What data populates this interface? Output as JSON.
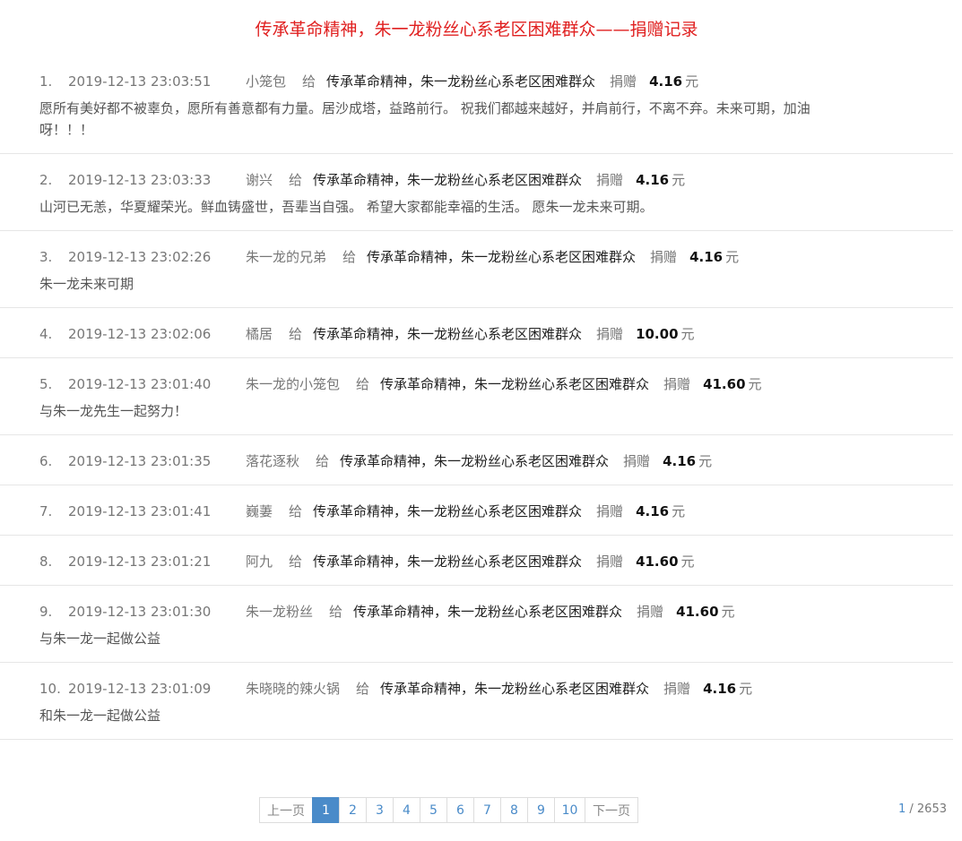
{
  "title": "传承革命精神，朱一龙粉丝心系老区困难群众——捐赠记录",
  "labels": {
    "give": "给",
    "donate": "捐赠",
    "unit": "元"
  },
  "records": [
    {
      "index": "1.",
      "time": "2019-12-13 23:03:51",
      "name": "小笼包",
      "project": "传承革命精神，朱一龙粉丝心系老区困难群众",
      "amount": "4.16",
      "message": "愿所有美好都不被辜负，愿所有善意都有力量。居沙成塔，益路前行。 祝我们都越来越好，并肩前行，不离不弃。未来可期，加油呀！！！"
    },
    {
      "index": "2.",
      "time": "2019-12-13 23:03:33",
      "name": "谢兴",
      "project": "传承革命精神，朱一龙粉丝心系老区困难群众",
      "amount": "4.16",
      "message": "山河已无恙，华夏耀荣光。鲜血铸盛世，吾辈当自强。 希望大家都能幸福的生活。 愿朱一龙未来可期。"
    },
    {
      "index": "3.",
      "time": "2019-12-13 23:02:26",
      "name": "朱一龙的兄弟",
      "project": "传承革命精神，朱一龙粉丝心系老区困难群众",
      "amount": "4.16",
      "message": "朱一龙未来可期"
    },
    {
      "index": "4.",
      "time": "2019-12-13 23:02:06",
      "name": "橘居",
      "project": "传承革命精神，朱一龙粉丝心系老区困难群众",
      "amount": "10.00",
      "message": ""
    },
    {
      "index": "5.",
      "time": "2019-12-13 23:01:40",
      "name": "朱一龙的小笼包",
      "project": "传承革命精神，朱一龙粉丝心系老区困难群众",
      "amount": "41.60",
      "message": "与朱一龙先生一起努力！"
    },
    {
      "index": "6.",
      "time": "2019-12-13 23:01:35",
      "name": "落花逐秋",
      "project": "传承革命精神，朱一龙粉丝心系老区困难群众",
      "amount": "4.16",
      "message": ""
    },
    {
      "index": "7.",
      "time": "2019-12-13 23:01:41",
      "name": "巍萋",
      "project": "传承革命精神，朱一龙粉丝心系老区困难群众",
      "amount": "4.16",
      "message": ""
    },
    {
      "index": "8.",
      "time": "2019-12-13 23:01:21",
      "name": "阿九",
      "project": "传承革命精神，朱一龙粉丝心系老区困难群众",
      "amount": "41.60",
      "message": ""
    },
    {
      "index": "9.",
      "time": "2019-12-13 23:01:30",
      "name": "朱一龙粉丝",
      "project": "传承革命精神，朱一龙粉丝心系老区困难群众",
      "amount": "41.60",
      "message": "与朱一龙一起做公益"
    },
    {
      "index": "10.",
      "time": "2019-12-13 23:01:09",
      "name": "朱晓晓的辣火锅",
      "project": "传承革命精神，朱一龙粉丝心系老区困难群众",
      "amount": "4.16",
      "message": "和朱一龙一起做公益"
    }
  ],
  "pagination": {
    "prev_label": "上一页",
    "next_label": "下一页",
    "pages": [
      "1",
      "2",
      "3",
      "4",
      "5",
      "6",
      "7",
      "8",
      "9",
      "10"
    ],
    "current": "1",
    "current_page_text": "1",
    "total_text": "/ 2653"
  }
}
